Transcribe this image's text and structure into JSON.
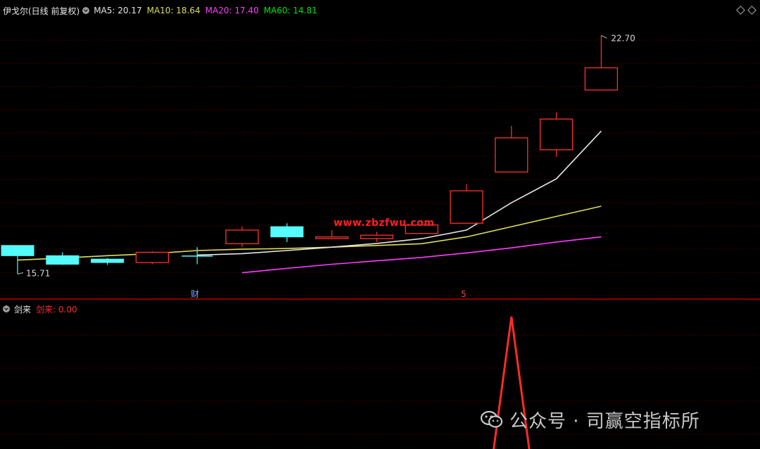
{
  "header": {
    "title": "伊戈尔(日线 前复权)",
    "ma5": "MA5: 20.17",
    "ma10": "MA10: 18.64",
    "ma20": "MA20: 17.40",
    "ma60": "MA60: 14.81"
  },
  "indicator": {
    "name": "剑来",
    "value_label": "剑来: 0.00"
  },
  "markers": {
    "cai": "财",
    "five": "5"
  },
  "watermark_center": "www.zbzfwu.com",
  "footer_watermark": "公众号 · 司赢空指标所",
  "colors": {
    "up": "#ff3232",
    "down": "#54fcfc",
    "ma5": "#e6e6e6",
    "ma10": "#dede5a",
    "ma20": "#ff3cff",
    "ma60": "#00e600",
    "grid": "#7a0000",
    "indicator": "#ff2a2a"
  },
  "chart_data": [
    {
      "type": "candlestick",
      "title": "伊戈尔(日线 前复权)",
      "ylim": [
        15.0,
        23.2
      ],
      "max_label": "22.70",
      "min_label": "15.71",
      "candles": [
        {
          "open": 16.55,
          "close": 16.25,
          "high": 16.55,
          "low": 15.71
        },
        {
          "open": 16.25,
          "close": 16.0,
          "high": 16.35,
          "low": 15.98
        },
        {
          "open": 16.15,
          "close": 16.05,
          "high": 16.18,
          "low": 15.98
        },
        {
          "open": 16.05,
          "close": 16.35,
          "high": 16.38,
          "low": 16.0
        },
        {
          "open": 16.24,
          "close": 16.24,
          "high": 16.5,
          "low": 16.0
        },
        {
          "open": 16.6,
          "close": 17.0,
          "high": 17.1,
          "low": 16.5
        },
        {
          "open": 17.1,
          "close": 16.8,
          "high": 17.2,
          "low": 16.65
        },
        {
          "open": 16.75,
          "close": 16.8,
          "high": 17.0,
          "low": 16.73
        },
        {
          "open": 16.75,
          "close": 16.85,
          "high": 16.95,
          "low": 16.65
        },
        {
          "open": 16.9,
          "close": 17.15,
          "high": 17.3,
          "low": 16.88
        },
        {
          "open": 17.2,
          "close": 18.15,
          "high": 18.35,
          "low": 17.2
        },
        {
          "open": 18.7,
          "close": 19.7,
          "high": 20.05,
          "low": 18.7
        },
        {
          "open": 19.35,
          "close": 20.25,
          "high": 20.45,
          "low": 19.15
        },
        {
          "open": 21.1,
          "close": 21.75,
          "high": 22.7,
          "low": 21.1
        }
      ],
      "ma5": [
        null,
        null,
        null,
        null,
        16.27,
        16.31,
        16.4,
        16.5,
        16.61,
        16.75,
        17.0,
        17.8,
        18.5,
        19.9
      ],
      "ma10": [
        16.12,
        16.18,
        16.25,
        16.31,
        16.4,
        16.44,
        16.46,
        16.5,
        16.55,
        16.6,
        16.8,
        17.1,
        17.4,
        17.7
      ],
      "ma20": [
        null,
        null,
        null,
        null,
        null,
        15.75,
        15.88,
        16.0,
        16.1,
        16.2,
        16.33,
        16.48,
        16.65,
        16.8
      ],
      "ma60": []
    },
    {
      "type": "line",
      "title": "剑来",
      "ylim": [
        0,
        1
      ],
      "x": [
        10.6,
        11.0,
        11.4
      ],
      "values": [
        0,
        1,
        0
      ]
    }
  ]
}
